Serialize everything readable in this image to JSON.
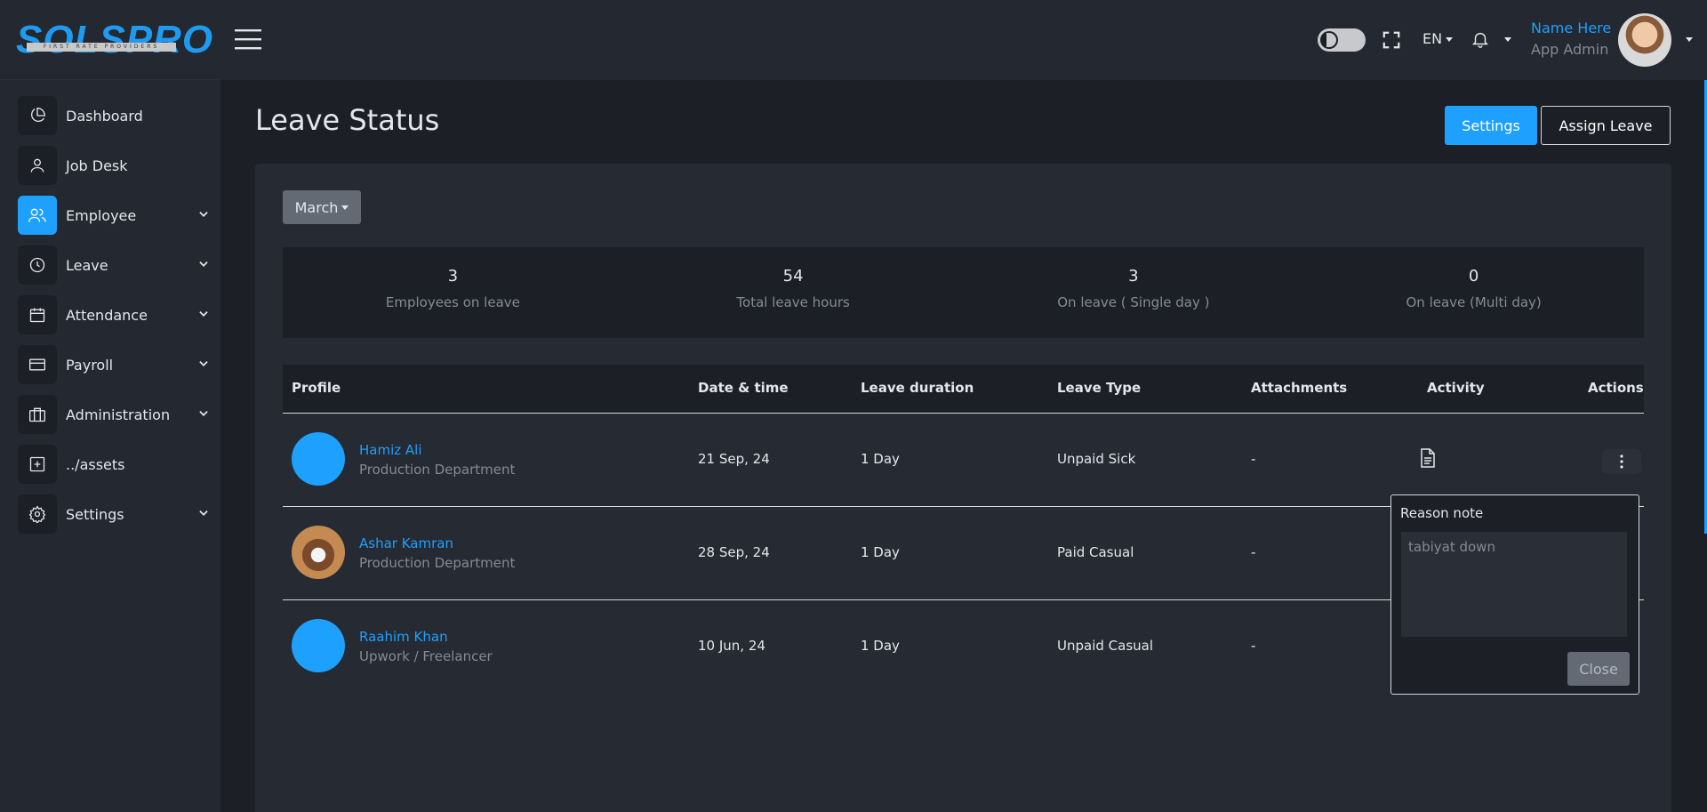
{
  "brand": {
    "logo_text": "SOLSPRO",
    "tagline": "FIRST RATE PROVIDERS"
  },
  "sidebar": {
    "items": [
      {
        "label": "Dashboard",
        "icon": "pie-chart-icon"
      },
      {
        "label": "Job Desk",
        "icon": "user-icon"
      },
      {
        "label": "Employee",
        "icon": "users-icon",
        "active": true
      },
      {
        "label": "Leave",
        "icon": "clock-icon"
      },
      {
        "label": "Attendance",
        "icon": "calendar-icon"
      },
      {
        "label": "Payroll",
        "icon": "credit-card-icon"
      },
      {
        "label": "Administration",
        "icon": "briefcase-icon"
      },
      {
        "label": "../assets",
        "icon": "plus-square-icon"
      },
      {
        "label": "Settings",
        "icon": "gear-icon"
      }
    ]
  },
  "header": {
    "lang": "EN",
    "user_name": "Name Here",
    "user_role": "App Admin"
  },
  "page": {
    "title": "Leave Status",
    "settings_label": "Settings",
    "assign_label": "Assign Leave",
    "month": "March"
  },
  "stats": [
    {
      "value": "3",
      "label": "Employees on leave"
    },
    {
      "value": "54",
      "label": "Total leave hours"
    },
    {
      "value": "3",
      "label": "On leave ( Single day )"
    },
    {
      "value": "0",
      "label": "On leave (Multi day)"
    }
  ],
  "table": {
    "columns": [
      "Profile",
      "Date & time",
      "Leave duration",
      "Leave Type",
      "Attachments",
      "Activity",
      "Actions"
    ],
    "rows": [
      {
        "name": "Hamiz Ali",
        "dept": "Production Department",
        "date": "21 Sep, 24",
        "duration": "1 Day",
        "type": "Unpaid Sick",
        "attachments": "-"
      },
      {
        "name": "Ashar Kamran",
        "dept": "Production Department",
        "date": "28 Sep, 24",
        "duration": "1 Day",
        "type": "Paid Casual",
        "attachments": "-"
      },
      {
        "name": "Raahim Khan",
        "dept": "Upwork / Freelancer",
        "date": "10 Jun, 24",
        "duration": "1 Day",
        "type": "Unpaid Casual",
        "attachments": "-"
      }
    ]
  },
  "popover": {
    "title": "Reason note",
    "note": "tabiyat down",
    "close_label": "Close"
  },
  "colors": {
    "accent": "#1ea0ff",
    "bg": "#1c1f26",
    "panel": "#242830"
  }
}
